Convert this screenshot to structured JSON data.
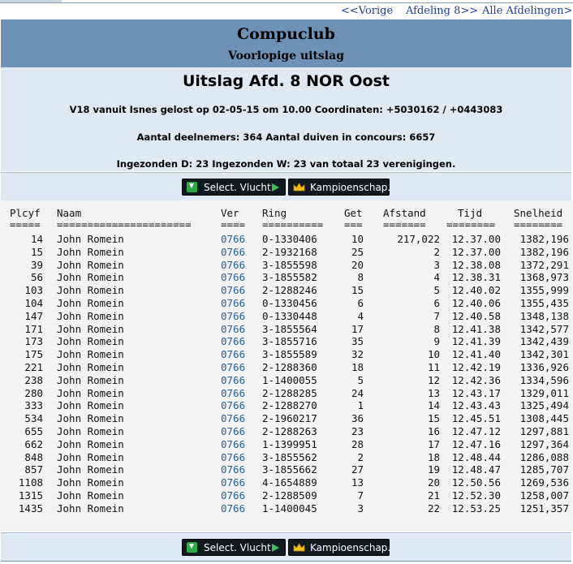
{
  "nav": {
    "prev": "<<Vorige",
    "next": "Afdeling 8>>",
    "all": "Alle Afdelingen>>"
  },
  "header": {
    "club": "Compuclub",
    "subtitle": "Voorlopige uitslag"
  },
  "info": {
    "heading": "Uitslag Afd. 8 NOR Oost",
    "line1": "V18 vanuit Isnes gelost op 02-05-15 om 10.00 Coordinaten: +5030162 / +0443083",
    "line2": "Aantal deelnemers: 364 Aantal duiven in concours: 6657",
    "line3": "Ingezonden D: 23 Ingezonden W: 23 van totaal 23 verenigingen."
  },
  "buttons": {
    "select": "Select. Vlucht",
    "kampioen": "Kampioenschap."
  },
  "table": {
    "headers": {
      "plc": "Plcyf",
      "naam": "Naam",
      "ver": "Ver",
      "ring": "Ring",
      "get": "Get",
      "afs": "Afstand",
      "tijd": "Tijd",
      "snel": "Snelheid"
    },
    "underline": {
      "plc": "=====",
      "naam": "======================",
      "ver": "====",
      "ring": "==========",
      "get": "===",
      "afs": "=======",
      "tijd": "========",
      "snel": "========"
    },
    "rows": [
      {
        "plc": "14",
        "naam": "John Romein",
        "ver": "0766",
        "ring": "0-1330406",
        "get": "10",
        "afs": "217,022",
        "tijd": "12.37.00",
        "snel": "1382,196"
      },
      {
        "plc": "15",
        "naam": "John Romein",
        "ver": "0766",
        "ring": "2-1932168",
        "get": "25",
        "afs": "2",
        "tijd": "12.37.00",
        "snel": "1382,196"
      },
      {
        "plc": "39",
        "naam": "John Romein",
        "ver": "0766",
        "ring": "3-1855598",
        "get": "20",
        "afs": "3",
        "tijd": "12.38.08",
        "snel": "1372,291"
      },
      {
        "plc": "56",
        "naam": "John Romein",
        "ver": "0766",
        "ring": "3-1855582",
        "get": "8",
        "afs": "4",
        "tijd": "12.38.31",
        "snel": "1368,973"
      },
      {
        "plc": "103",
        "naam": "John Romein",
        "ver": "0766",
        "ring": "2-1288246",
        "get": "15",
        "afs": "5",
        "tijd": "12.40.02",
        "snel": "1355,999"
      },
      {
        "plc": "104",
        "naam": "John Romein",
        "ver": "0766",
        "ring": "0-1330456",
        "get": "6",
        "afs": "6",
        "tijd": "12.40.06",
        "snel": "1355,435"
      },
      {
        "plc": "147",
        "naam": "John Romein",
        "ver": "0766",
        "ring": "0-1330448",
        "get": "4",
        "afs": "7",
        "tijd": "12.40.58",
        "snel": "1348,138"
      },
      {
        "plc": "171",
        "naam": "John Romein",
        "ver": "0766",
        "ring": "3-1855564",
        "get": "17",
        "afs": "8",
        "tijd": "12.41.38",
        "snel": "1342,577"
      },
      {
        "plc": "173",
        "naam": "John Romein",
        "ver": "0766",
        "ring": "3-1855716",
        "get": "35",
        "afs": "9",
        "tijd": "12.41.39",
        "snel": "1342,439"
      },
      {
        "plc": "175",
        "naam": "John Romein",
        "ver": "0766",
        "ring": "3-1855589",
        "get": "32",
        "afs": "10",
        "tijd": "12.41.40",
        "snel": "1342,301"
      },
      {
        "plc": "221",
        "naam": "John Romein",
        "ver": "0766",
        "ring": "2-1288360",
        "get": "18",
        "afs": "11",
        "tijd": "12.42.19",
        "snel": "1336,926"
      },
      {
        "plc": "238",
        "naam": "John Romein",
        "ver": "0766",
        "ring": "1-1400055",
        "get": "5",
        "afs": "12",
        "tijd": "12.42.36",
        "snel": "1334,596"
      },
      {
        "plc": "280",
        "naam": "John Romein",
        "ver": "0766",
        "ring": "2-1288285",
        "get": "24",
        "afs": "13",
        "tijd": "12.43.17",
        "snel": "1329,011"
      },
      {
        "plc": "333",
        "naam": "John Romein",
        "ver": "0766",
        "ring": "2-1288270",
        "get": "1",
        "afs": "14",
        "tijd": "12.43.43",
        "snel": "1325,494"
      },
      {
        "plc": "534",
        "naam": "John Romein",
        "ver": "0766",
        "ring": "2-1960217",
        "get": "36",
        "afs": "15",
        "tijd": "12.45.51",
        "snel": "1308,445"
      },
      {
        "plc": "655",
        "naam": "John Romein",
        "ver": "0766",
        "ring": "2-1288263",
        "get": "23",
        "afs": "16",
        "tijd": "12.47.12",
        "snel": "1297,881"
      },
      {
        "plc": "662",
        "naam": "John Romein",
        "ver": "0766",
        "ring": "1-1399951",
        "get": "28",
        "afs": "17",
        "tijd": "12.47.16",
        "snel": "1297,364"
      },
      {
        "plc": "848",
        "naam": "John Romein",
        "ver": "0766",
        "ring": "3-1855562",
        "get": "2",
        "afs": "18",
        "tijd": "12.48.44",
        "snel": "1286,088"
      },
      {
        "plc": "857",
        "naam": "John Romein",
        "ver": "0766",
        "ring": "3-1855662",
        "get": "27",
        "afs": "19",
        "tijd": "12.48.47",
        "snel": "1285,707"
      },
      {
        "plc": "1108",
        "naam": "John Romein",
        "ver": "0766",
        "ring": "4-1654889",
        "get": "13",
        "afs": "20",
        "tijd": "12.50.56",
        "snel": "1269,536"
      },
      {
        "plc": "1315",
        "naam": "John Romein",
        "ver": "0766",
        "ring": "2-1288509",
        "get": "7",
        "afs": "21",
        "tijd": "12.52.30",
        "snel": "1258,007"
      },
      {
        "plc": "1435",
        "naam": "John Romein",
        "ver": "0766",
        "ring": "1-1400045",
        "get": "3",
        "afs": "22",
        "tijd": "12.53.25",
        "snel": "1251,357"
      }
    ]
  },
  "colors": {
    "header_band": "#6e92b6",
    "info_band": "#dfe9f3",
    "link": "#1d3e9c",
    "ver_link": "#28609a"
  }
}
